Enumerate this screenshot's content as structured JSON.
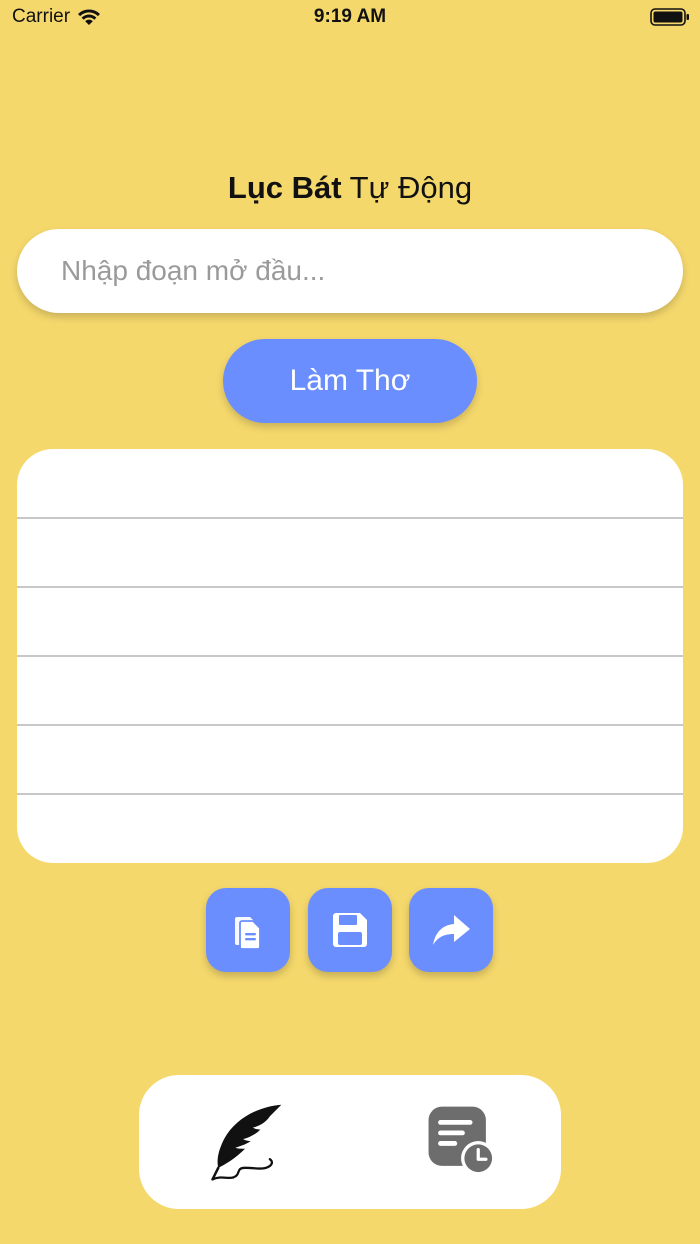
{
  "status_bar": {
    "carrier": "Carrier",
    "time": "9:19 AM"
  },
  "header": {
    "title_bold": "Lục Bát",
    "title_regular": " Tự Động"
  },
  "input": {
    "value": "",
    "placeholder": "Nhập đoạn mở đầu..."
  },
  "make_button": {
    "label": "Làm Thơ"
  },
  "poem": {
    "lines": [
      "",
      "",
      "",
      "",
      "",
      ""
    ]
  },
  "actions": [
    {
      "name": "copy-button",
      "icon": "copy-icon"
    },
    {
      "name": "save-button",
      "icon": "floppy-disk-icon"
    },
    {
      "name": "share-button",
      "icon": "share-arrow-icon"
    }
  ],
  "tabs": [
    {
      "name": "tab-compose",
      "icon": "feather-quill-icon",
      "selected": true
    },
    {
      "name": "tab-history",
      "icon": "history-list-clock-icon",
      "selected": false
    }
  ],
  "colors": {
    "background": "#F5D86C",
    "accent": "#6B8EFF",
    "card": "#FFFFFF",
    "divider": "#C8C8C8"
  }
}
